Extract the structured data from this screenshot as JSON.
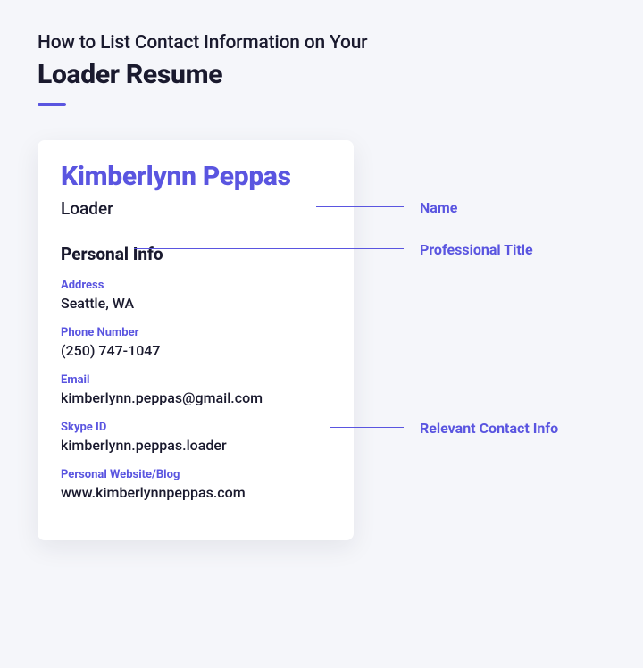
{
  "header": {
    "small": "How to List Contact Information on Your",
    "large": "Loader Resume"
  },
  "card": {
    "name": "Kimberlynn Peppas",
    "title": "Loader",
    "section_heading": "Personal Info",
    "fields": {
      "address": {
        "label": "Address",
        "value": "Seattle, WA"
      },
      "phone": {
        "label": "Phone Number",
        "value": "(250) 747-1047"
      },
      "email": {
        "label": "Email",
        "value": "kimberlynn.peppas@gmail.com"
      },
      "skype": {
        "label": "Skype ID",
        "value": "kimberlynn.peppas.loader"
      },
      "website": {
        "label": "Personal Website/Blog",
        "value": "www.kimberlynnpeppas.com"
      }
    }
  },
  "annotations": {
    "name": "Name",
    "title": "Professional Title",
    "contact": "Relevant Contact Info"
  }
}
